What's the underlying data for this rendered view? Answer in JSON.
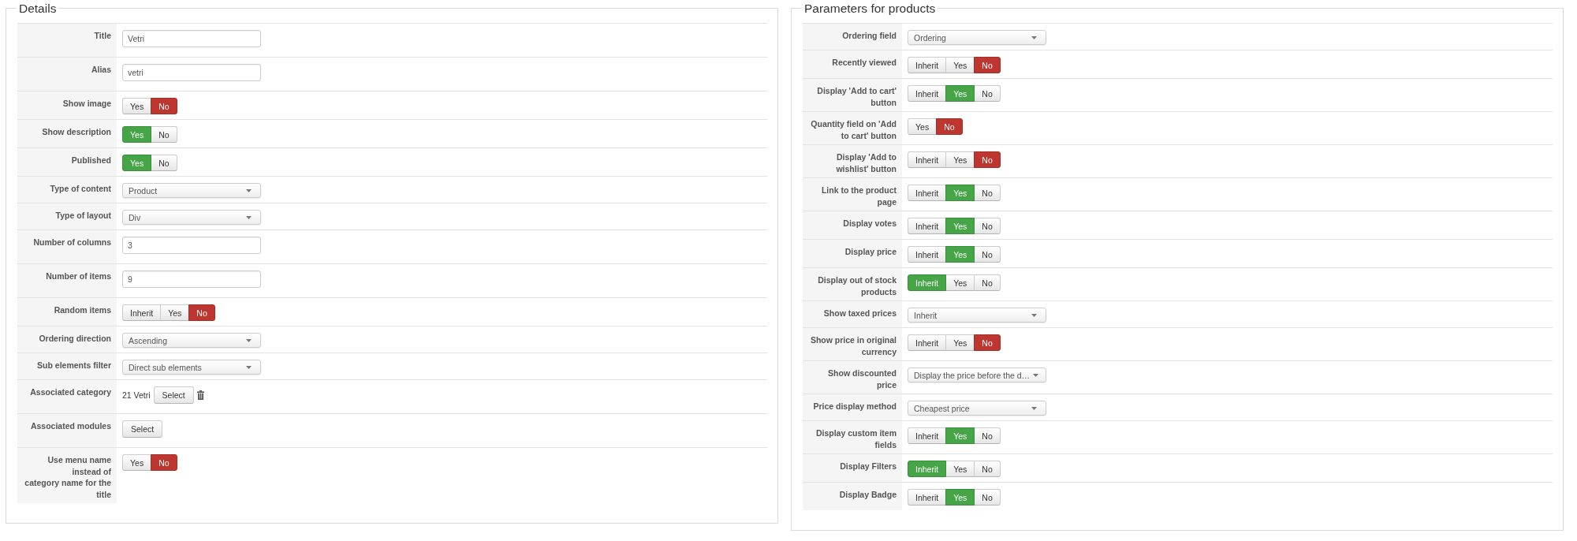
{
  "panels": [
    {
      "title": "Details",
      "fields": [
        {
          "label": "Title",
          "kind": "text",
          "value": "Vetri"
        },
        {
          "label": "Alias",
          "kind": "text",
          "value": "vetri"
        },
        {
          "label": "Show image",
          "kind": "toggle",
          "options": [
            {
              "label": "Yes",
              "selected": false
            },
            {
              "label": "No",
              "selected": true
            }
          ]
        },
        {
          "label": "Show description",
          "kind": "toggle",
          "options": [
            {
              "label": "Yes",
              "selected": true
            },
            {
              "label": "No",
              "selected": false
            }
          ]
        },
        {
          "label": "Published",
          "kind": "toggle",
          "options": [
            {
              "label": "Yes",
              "selected": true
            },
            {
              "label": "No",
              "selected": false
            }
          ]
        },
        {
          "label": "Type of content",
          "kind": "select",
          "value": "Product"
        },
        {
          "label": "Type of layout",
          "kind": "select",
          "value": "Div"
        },
        {
          "label": "Number of columns",
          "kind": "text",
          "value": "3"
        },
        {
          "label": "Number of items",
          "kind": "text",
          "value": "9"
        },
        {
          "label": "Random items",
          "kind": "toggle",
          "options": [
            {
              "label": "Inherit",
              "selected": false
            },
            {
              "label": "Yes",
              "selected": false
            },
            {
              "label": "No",
              "selected": true
            }
          ]
        },
        {
          "label": "Ordering direction",
          "kind": "select",
          "value": "Ascending"
        },
        {
          "label": "Sub elements filter",
          "kind": "select",
          "value": "Direct sub elements"
        },
        {
          "label": "Associated category",
          "kind": "picker",
          "value": "21 Vetri",
          "button": "Select"
        },
        {
          "label": "Associated modules",
          "kind": "button",
          "button": "Select"
        },
        {
          "label": "Use menu name\ninstead of\ncategory name for the\ntitle",
          "kind": "toggle",
          "options": [
            {
              "label": "Yes",
              "selected": false
            },
            {
              "label": "No",
              "selected": true
            }
          ]
        }
      ]
    },
    {
      "title": "Parameters for products",
      "fields": [
        {
          "label": "Ordering field",
          "kind": "select",
          "value": "Ordering"
        },
        {
          "label": "Recently viewed",
          "kind": "toggle",
          "options": [
            {
              "label": "Inherit",
              "selected": false
            },
            {
              "label": "Yes",
              "selected": false
            },
            {
              "label": "No",
              "selected": true
            }
          ]
        },
        {
          "label": "Display 'Add to cart' button",
          "kind": "toggle",
          "options": [
            {
              "label": "Inherit",
              "selected": false
            },
            {
              "label": "Yes",
              "selected": true
            },
            {
              "label": "No",
              "selected": false
            }
          ]
        },
        {
          "label": "Quantity field on 'Add to cart' button",
          "kind": "toggle",
          "options": [
            {
              "label": "Yes",
              "selected": false
            },
            {
              "label": "No",
              "selected": true
            }
          ]
        },
        {
          "label": "Display 'Add to wishlist' button",
          "kind": "toggle",
          "options": [
            {
              "label": "Inherit",
              "selected": false
            },
            {
              "label": "Yes",
              "selected": false
            },
            {
              "label": "No",
              "selected": true
            }
          ]
        },
        {
          "label": "Link to the product page",
          "kind": "toggle",
          "options": [
            {
              "label": "Inherit",
              "selected": false
            },
            {
              "label": "Yes",
              "selected": true
            },
            {
              "label": "No",
              "selected": false
            }
          ]
        },
        {
          "label": "Display votes",
          "kind": "toggle",
          "options": [
            {
              "label": "Inherit",
              "selected": false
            },
            {
              "label": "Yes",
              "selected": true
            },
            {
              "label": "No",
              "selected": false
            }
          ]
        },
        {
          "label": "Display price",
          "kind": "toggle",
          "options": [
            {
              "label": "Inherit",
              "selected": false
            },
            {
              "label": "Yes",
              "selected": true
            },
            {
              "label": "No",
              "selected": false
            }
          ]
        },
        {
          "label": "Display out of stock products",
          "kind": "toggle",
          "options": [
            {
              "label": "Inherit",
              "selected": true
            },
            {
              "label": "Yes",
              "selected": false
            },
            {
              "label": "No",
              "selected": false
            }
          ]
        },
        {
          "label": "Show taxed prices",
          "kind": "select",
          "value": "Inherit"
        },
        {
          "label": "Show price in original currency",
          "kind": "toggle",
          "options": [
            {
              "label": "Inherit",
              "selected": false
            },
            {
              "label": "Yes",
              "selected": false
            },
            {
              "label": "No",
              "selected": true
            }
          ]
        },
        {
          "label": "Show discounted price",
          "kind": "select",
          "value": "Display the price before the d…"
        },
        {
          "label": "Price display method",
          "kind": "select",
          "value": "Cheapest price"
        },
        {
          "label": "Display custom item fields",
          "kind": "toggle",
          "options": [
            {
              "label": "Inherit",
              "selected": false
            },
            {
              "label": "Yes",
              "selected": true
            },
            {
              "label": "No",
              "selected": false
            }
          ]
        },
        {
          "label": "Display Filters",
          "kind": "toggle",
          "options": [
            {
              "label": "Inherit",
              "selected": true
            },
            {
              "label": "Yes",
              "selected": false
            },
            {
              "label": "No",
              "selected": false
            }
          ]
        },
        {
          "label": "Display Badge",
          "kind": "toggle",
          "options": [
            {
              "label": "Inherit",
              "selected": false
            },
            {
              "label": "Yes",
              "selected": true
            },
            {
              "label": "No",
              "selected": false
            }
          ]
        }
      ]
    }
  ]
}
